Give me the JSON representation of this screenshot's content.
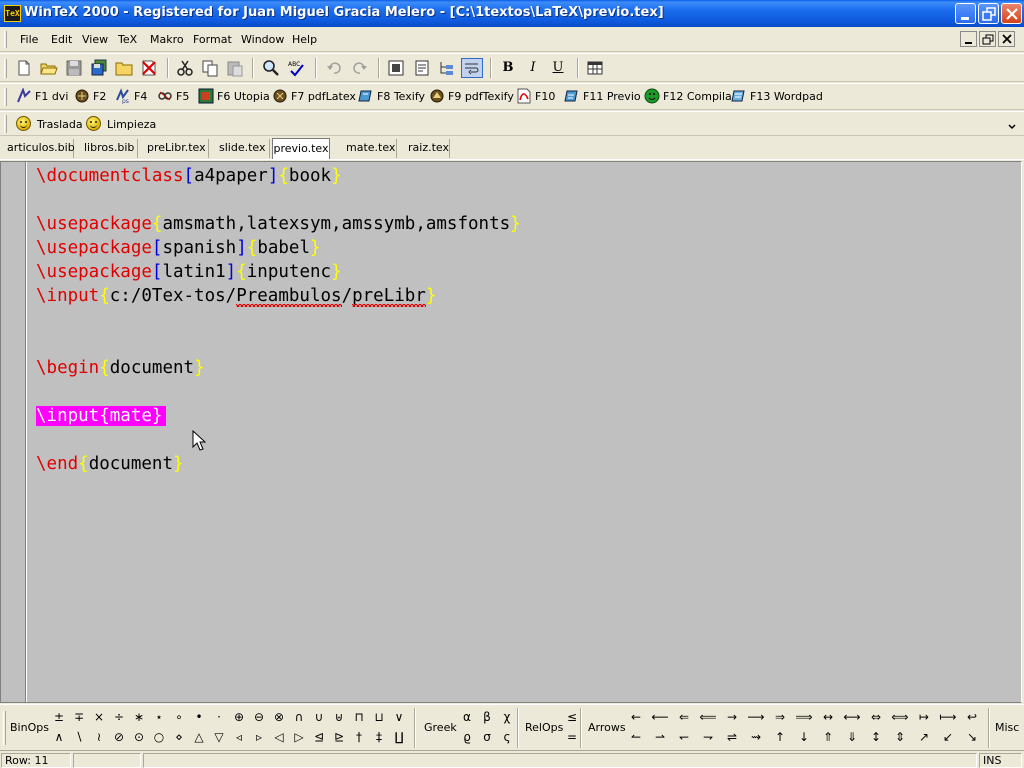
{
  "window": {
    "title": "WinTeX 2000 - Registered for Juan Miguel Gracia Melero - [C:\\1textos\\LaTeX\\previo.tex]",
    "app_icon_text": "TeX"
  },
  "menu": [
    "File",
    "Edit",
    "View",
    "TeX",
    "Makro",
    "Format",
    "Window",
    "Help"
  ],
  "function_keys": [
    {
      "label": "F1 dvi",
      "icon": "dvi-icon"
    },
    {
      "label": "F2",
      "icon": "compile-icon"
    },
    {
      "label": "F4",
      "icon": "dvips-icon"
    },
    {
      "label": "F5",
      "icon": "preview-icon"
    },
    {
      "label": "F6 Utopia",
      "icon": "utopia-icon"
    },
    {
      "label": "F7 pdfLatex",
      "icon": "pdflatex-icon"
    },
    {
      "label": "F8 Texify",
      "icon": "texify-icon"
    },
    {
      "label": "F9 pdfTexify",
      "icon": "pdftexify-icon"
    },
    {
      "label": "F10",
      "icon": "pdf-icon"
    },
    {
      "label": "F11 Previo",
      "icon": "previo-icon"
    },
    {
      "label": "F12 Compila",
      "icon": "compila-icon"
    },
    {
      "label": "F13 Wordpad",
      "icon": "wordpad-icon"
    }
  ],
  "macros": [
    {
      "label": "Traslada",
      "icon": "smiley-icon"
    },
    {
      "label": "Limpieza",
      "icon": "smiley-icon"
    }
  ],
  "format_buttons": {
    "bold": "B",
    "italic": "I",
    "underline": "U"
  },
  "tabs": [
    {
      "label": "articulos.bib",
      "active": false
    },
    {
      "label": "libros.bib",
      "active": false
    },
    {
      "label": "preLibr.tex",
      "active": false
    },
    {
      "label": "slide.tex",
      "active": false
    },
    {
      "label": "previo.tex",
      "active": true
    },
    {
      "label": "mate.tex",
      "active": false
    },
    {
      "label": "raiz.tex",
      "active": false
    }
  ],
  "editor": {
    "lines": [
      {
        "kw": "\\documentclass",
        "parts": [
          [
            "br",
            "["
          ],
          [
            "tx",
            "a4paper"
          ],
          [
            "br",
            "]"
          ],
          [
            "bc",
            "{"
          ],
          [
            "tx",
            "book"
          ],
          [
            "bc",
            "}"
          ]
        ]
      },
      {
        "kw": "\\usepackage",
        "parts": [
          [
            "bc",
            "{"
          ],
          [
            "tx",
            "amsmath,latexsym,amssymb,amsfonts"
          ],
          [
            "bc",
            "}"
          ]
        ]
      },
      {
        "kw": "\\usepackage",
        "parts": [
          [
            "br",
            "["
          ],
          [
            "tx",
            "spanish"
          ],
          [
            "br",
            "]"
          ],
          [
            "bc",
            "{"
          ],
          [
            "tx",
            "babel"
          ],
          [
            "bc",
            "}"
          ]
        ]
      },
      {
        "kw": "\\usepackage",
        "parts": [
          [
            "br",
            "["
          ],
          [
            "tx",
            "latin1"
          ],
          [
            "br",
            "]"
          ],
          [
            "bc",
            "{"
          ],
          [
            "tx",
            "inputenc"
          ],
          [
            "bc",
            "}"
          ]
        ]
      },
      {
        "kw": "\\input",
        "parts": [
          [
            "bc",
            "{"
          ],
          [
            "tx",
            "c:/0Tex-tos/"
          ],
          [
            "sq",
            "Preambulos"
          ],
          [
            "tx",
            "/"
          ],
          [
            "sq",
            "preLibr"
          ],
          [
            "bc",
            "}"
          ]
        ]
      },
      {
        "kw": "\\begin",
        "parts": [
          [
            "bc",
            "{"
          ],
          [
            "tx",
            "document"
          ],
          [
            "bc",
            "}"
          ]
        ]
      },
      {
        "highlight": "\\input{mate}"
      },
      {
        "kw": "\\end",
        "parts": [
          [
            "bc",
            "{"
          ],
          [
            "tx",
            "document"
          ],
          [
            "bc",
            "}"
          ]
        ]
      }
    ]
  },
  "palette": {
    "groups": [
      "BinOps",
      "Greek",
      "RelOps",
      "Arrows",
      "Misc"
    ],
    "binops_row1": [
      "±",
      "∓",
      "×",
      "÷",
      "∗",
      "⋆",
      "∘",
      "•",
      "·",
      "⊕",
      "⊖",
      "⊗",
      "∩",
      "∪",
      "⊎",
      "⊓",
      "⊔",
      "∨"
    ],
    "binops_row2": [
      "∧",
      "∖",
      "≀",
      "⊘",
      "⊙",
      "○",
      "⋄",
      "△",
      "▽",
      "◃",
      "▹",
      "◁",
      "▷",
      "⊴",
      "⊵",
      "†",
      "‡",
      "∐"
    ],
    "greek_row1": [
      "α",
      "β",
      "χ"
    ],
    "greek_row2": [
      "ϱ",
      "σ",
      "ς"
    ],
    "relops_row1": [
      "≤"
    ],
    "relops_row2": [
      "="
    ],
    "arrows_row1": [
      "←",
      "⟵",
      "⇐",
      "⟸",
      "→",
      "⟶",
      "⇒",
      "⟹",
      "↔",
      "⟷",
      "⇔",
      "⟺",
      "↦",
      "⟼",
      "↩"
    ],
    "arrows_row2": [
      "↼",
      "⇀",
      "↽",
      "⇁",
      "⇌",
      "⇝",
      "↑",
      "↓",
      "⇑",
      "⇓",
      "↕",
      "⇕",
      "↗",
      "↙",
      "↘"
    ]
  },
  "status": {
    "row": "Row: 11",
    "mode": "INS"
  }
}
